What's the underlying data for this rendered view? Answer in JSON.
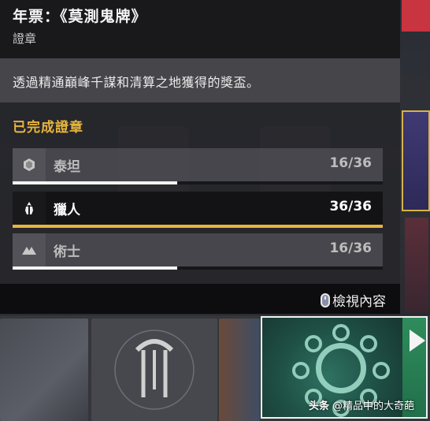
{
  "tooltip": {
    "title": "年票：《莫測鬼牌》",
    "subtitle": "證章",
    "description": "透過精通巔峰千謀和清算之地獲得的獎盃。",
    "section_title": "已完成證章",
    "rows": [
      {
        "icon": "titan-class-icon",
        "label": "泰坦",
        "count": "16/36",
        "progress": 0.444,
        "active": false
      },
      {
        "icon": "hunter-class-icon",
        "label": "獵人",
        "count": "36/36",
        "progress": 1.0,
        "active": true
      },
      {
        "icon": "warlock-class-icon",
        "label": "術士",
        "count": "16/36",
        "progress": 0.444,
        "active": false
      }
    ],
    "footer_action": "檢視內容"
  },
  "watermark": {
    "brand": "头条",
    "handle": "@精品中的大奇葩"
  },
  "colors": {
    "accent_gold": "#e6b53e",
    "selected_border": "#f2f2f2"
  }
}
